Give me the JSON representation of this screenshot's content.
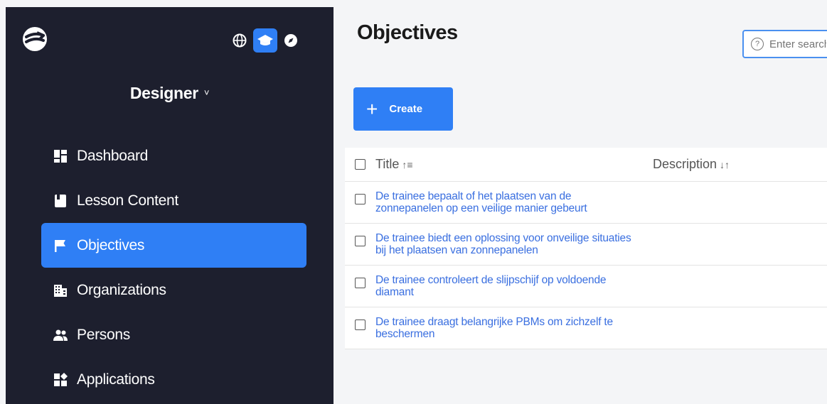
{
  "sidebar": {
    "role": "Designer",
    "nav": [
      {
        "label": "Dashboard",
        "icon": "dashboard-icon"
      },
      {
        "label": "Lesson Content",
        "icon": "book-icon"
      },
      {
        "label": "Objectives",
        "icon": "flag-icon",
        "active": true
      },
      {
        "label": "Organizations",
        "icon": "building-icon"
      },
      {
        "label": "Persons",
        "icon": "people-icon"
      },
      {
        "label": "Applications",
        "icon": "apps-icon"
      }
    ]
  },
  "main": {
    "title": "Objectives",
    "search": {
      "placeholder": "Enter search"
    },
    "create_label": "Create",
    "table": {
      "columns": [
        "Title",
        "Description"
      ],
      "rows": [
        {
          "title": "De trainee bepaalt of het plaatsen van de zonnepanelen op een veilige manier gebeurt",
          "description": ""
        },
        {
          "title": "De trainee biedt een oplossing voor onveilige situaties bij het plaatsen van zonnepanelen",
          "description": ""
        },
        {
          "title": "De trainee controleert de slijpschijf op voldoende diamant",
          "description": ""
        },
        {
          "title": "De trainee draagt belangrijke PBMs om zichzelf te beschermen",
          "description": ""
        }
      ]
    }
  },
  "colors": {
    "sidebar_bg": "#1d1f2e",
    "accent": "#2f7ff5",
    "link": "#3a6fe0"
  }
}
